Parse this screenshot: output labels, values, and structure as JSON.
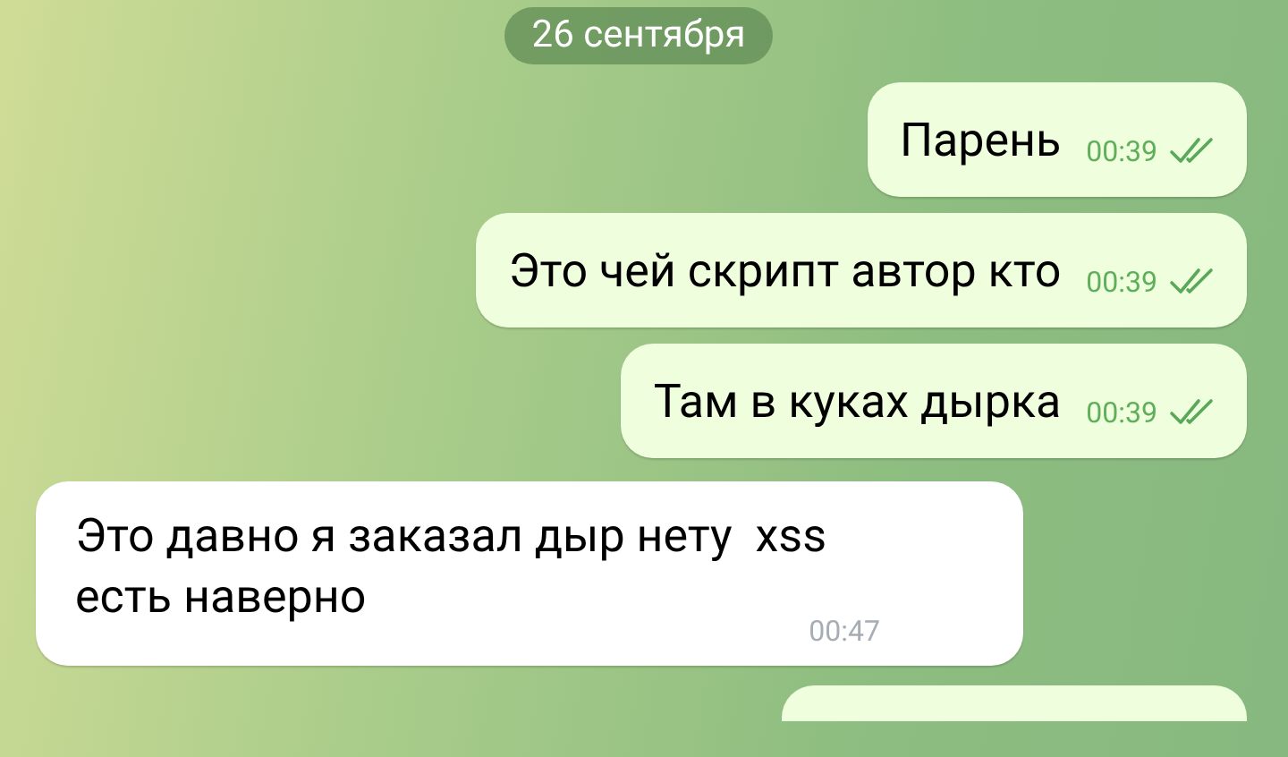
{
  "date_badge": "26 сентября",
  "messages": [
    {
      "kind": "outgoing",
      "text": "Парень",
      "time": "00:39",
      "read": true
    },
    {
      "kind": "outgoing",
      "text": "Это чей скрипт автор кто",
      "time": "00:39",
      "read": true
    },
    {
      "kind": "outgoing",
      "text": "Там в куках дырка",
      "time": "00:39",
      "read": true
    },
    {
      "kind": "incoming",
      "text": "Это давно я заказал дыр нету  xss есть наверно",
      "time": "00:47"
    }
  ]
}
